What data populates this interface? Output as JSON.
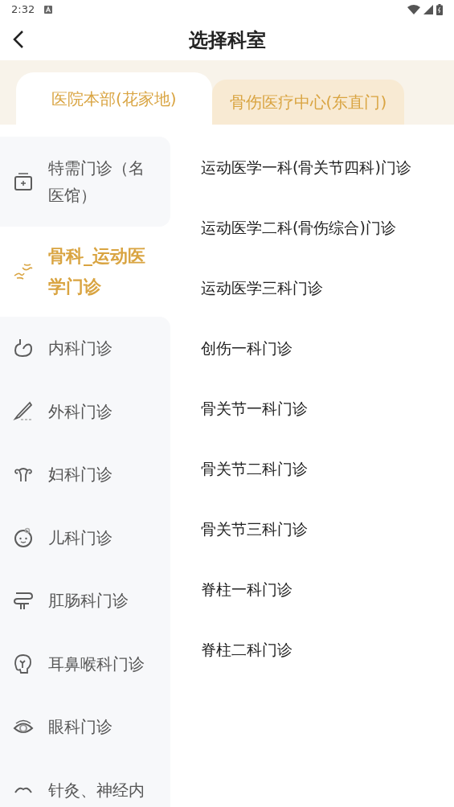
{
  "status_bar": {
    "time": "2:32"
  },
  "header": {
    "title": "选择科室"
  },
  "tabs": [
    {
      "label": "医院本部(花家地)",
      "selected": true
    },
    {
      "label": "骨伤医疗中心(东直门)",
      "selected": false
    }
  ],
  "categories": [
    {
      "label": "特需门诊（名医馆）",
      "selected": false
    },
    {
      "label": "骨科_运动医学门诊",
      "selected": true
    },
    {
      "label": "内科门诊",
      "selected": false
    },
    {
      "label": "外科门诊",
      "selected": false
    },
    {
      "label": "妇科门诊",
      "selected": false
    },
    {
      "label": "儿科门诊",
      "selected": false
    },
    {
      "label": "肛肠科门诊",
      "selected": false
    },
    {
      "label": "耳鼻喉科门诊",
      "selected": false
    },
    {
      "label": "眼科门诊",
      "selected": false
    },
    {
      "label": "针灸、神经内",
      "selected": false
    }
  ],
  "departments": [
    "运动医学一科(骨关节四科)门诊",
    "运动医学二科(骨伤综合)门诊",
    "运动医学三科门诊",
    "创伤一科门诊",
    "骨关节一科门诊",
    "骨关节二科门诊",
    "骨关节三科门诊",
    "脊柱一科门诊",
    "脊柱二科门诊"
  ]
}
